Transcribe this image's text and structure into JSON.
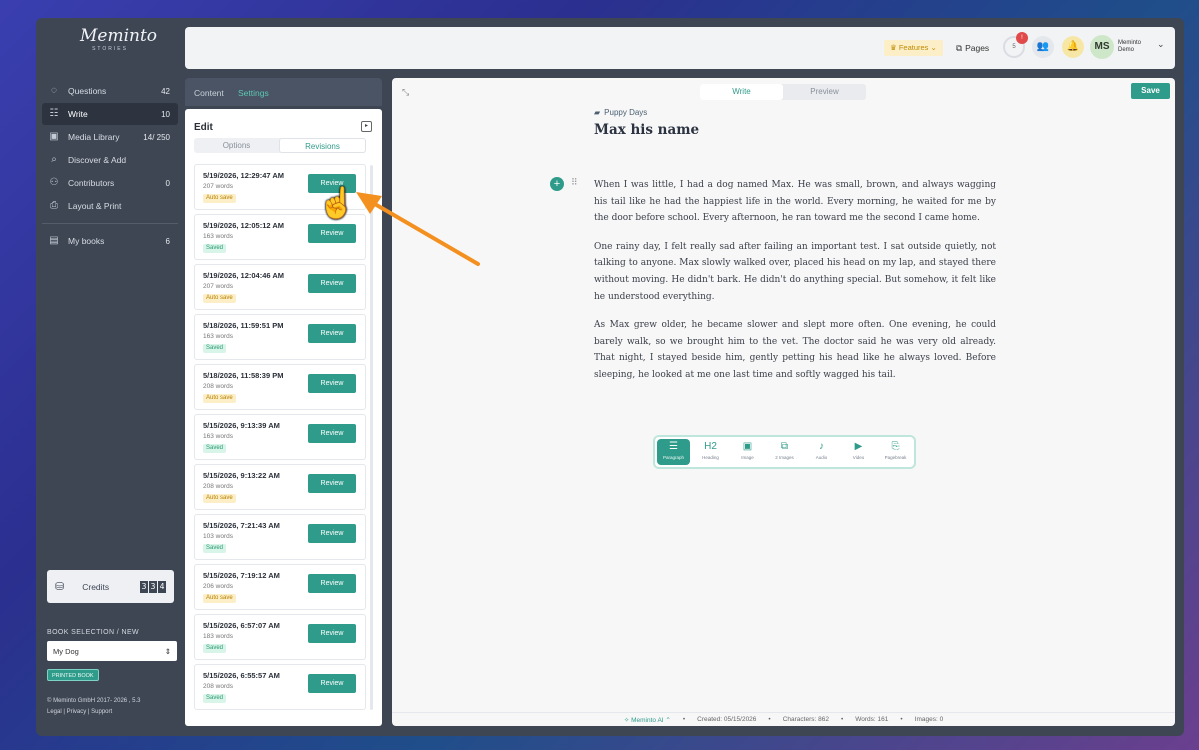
{
  "app": {
    "brand": "Meminto",
    "brand_sub": "STORIES"
  },
  "sidebar": {
    "items": [
      {
        "label": "Questions",
        "count": "42",
        "icon": "chat-icon"
      },
      {
        "label": "Write",
        "count": "10",
        "icon": "write-icon",
        "active": true
      },
      {
        "label": "Media Library",
        "count": "14/ 250",
        "icon": "media-icon"
      },
      {
        "label": "Discover & Add",
        "count": "",
        "icon": "discover-icon"
      },
      {
        "label": "Contributors",
        "count": "0",
        "icon": "contributors-icon"
      },
      {
        "label": "Layout & Print",
        "count": "",
        "icon": "print-icon"
      },
      {
        "label": "My books",
        "count": "6",
        "icon": "books-icon"
      }
    ],
    "credits_label": "Credits",
    "credits_digits": [
      "3",
      "3",
      "4"
    ],
    "book_selection_title": "BOOK SELECTION / NEW",
    "book_selected": "My Dog",
    "printed_book": "PRINTED BOOK",
    "copyright": "© Meminto GmbH 2017- 2026 , 5.3",
    "legal": "Legal",
    "privacy": "Privacy",
    "support": "Support"
  },
  "header": {
    "features": "Features",
    "pages": "Pages",
    "ring_value": "5",
    "notif_count": "!",
    "avatar": "MS",
    "user_line1": "Meminto",
    "user_line2": "Demo"
  },
  "panel": {
    "tab_content": "Content",
    "tab_settings": "Settings",
    "edit_title": "Edit",
    "seg_options": "Options",
    "seg_revisions": "Revisions",
    "review_label": "Review",
    "revisions": [
      {
        "date": "5/19/2026, 12:29:47 AM",
        "words": "207 words",
        "status": "Auto save"
      },
      {
        "date": "5/19/2026, 12:05:12 AM",
        "words": "163 words",
        "status": "Saved"
      },
      {
        "date": "5/19/2026, 12:04:46 AM",
        "words": "207 words",
        "status": "Auto save"
      },
      {
        "date": "5/18/2026, 11:59:51 PM",
        "words": "163 words",
        "status": "Saved"
      },
      {
        "date": "5/18/2026, 11:58:39 PM",
        "words": "208 words",
        "status": "Auto save"
      },
      {
        "date": "5/15/2026, 9:13:39 AM",
        "words": "163 words",
        "status": "Saved"
      },
      {
        "date": "5/15/2026, 9:13:22 AM",
        "words": "208 words",
        "status": "Auto save"
      },
      {
        "date": "5/15/2026, 7:21:43 AM",
        "words": "103 words",
        "status": "Saved"
      },
      {
        "date": "5/15/2026, 7:19:12 AM",
        "words": "206 words",
        "status": "Auto save"
      },
      {
        "date": "5/15/2026, 6:57:07 AM",
        "words": "183 words",
        "status": "Saved"
      },
      {
        "date": "5/15/2026, 6:55:57 AM",
        "words": "208 words",
        "status": "Saved"
      }
    ]
  },
  "editor": {
    "tab_write": "Write",
    "tab_preview": "Preview",
    "save": "Save",
    "folder": "Puppy Days",
    "title": "Max his name",
    "paragraphs": [
      "When I was little, I had a dog named Max. He was small, brown, and always wagging his tail like he had the happiest life in the world. Every morning, he waited for me by the door before school. Every afternoon, he ran toward me the second I came home.",
      "One rainy day, I felt really sad after failing an important test. I sat outside quietly, not talking to anyone. Max slowly walked over, placed his head on my lap, and stayed there without moving. He didn't bark. He didn't do anything special. But somehow, it felt like he understood everything.",
      "As Max grew older, he became slower and slept more often. One evening, he could barely walk, so we brought him to the vet. The doctor said he was very old already. That night, I stayed beside him, gently petting his head like he always loved. Before sleeping, he looked at me one last time and softly wagged his tail."
    ],
    "blocks": [
      {
        "label": "Paragraph",
        "icon": "paragraph-icon",
        "glyph": "☰"
      },
      {
        "label": "Heading",
        "icon": "heading-icon",
        "glyph": "H2"
      },
      {
        "label": "Image",
        "icon": "image-icon",
        "glyph": "▣"
      },
      {
        "label": "2 Images",
        "icon": "two-images-icon",
        "glyph": "⧉"
      },
      {
        "label": "Audio",
        "icon": "mic-icon",
        "glyph": "♪"
      },
      {
        "label": "Video",
        "icon": "video-icon",
        "glyph": "▶"
      },
      {
        "label": "Pagebreak",
        "icon": "pagebreak-icon",
        "glyph": "⎘"
      }
    ],
    "status": {
      "ai": "Meminto AI",
      "created": "Created: 05/15/2026",
      "characters": "Characters: 862",
      "words": "Words: 161",
      "images": "Images: 0"
    }
  },
  "colors": {
    "accent": "#2f9b8a",
    "sidebar_bg": "#3e4654",
    "auto_save": "#fcefc8",
    "saved": "#d9f4e9"
  }
}
